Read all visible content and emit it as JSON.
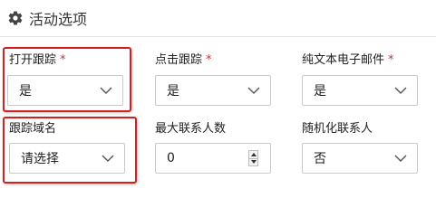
{
  "section": {
    "title": "活动选项",
    "icon": "gear-icon"
  },
  "required_mark": "*",
  "fields": {
    "open_tracking": {
      "label": "打开跟踪",
      "required": true,
      "value": "是"
    },
    "click_tracking": {
      "label": "点击跟踪",
      "required": true,
      "value": "是"
    },
    "plain_text_email": {
      "label": "纯文本电子邮件",
      "required": true,
      "value": "是"
    },
    "tracking_domain": {
      "label": "跟踪域名",
      "required": false,
      "value": "请选择"
    },
    "max_contacts": {
      "label": "最大联系人数",
      "required": false,
      "value": "0"
    },
    "randomize_contacts": {
      "label": "随机化联系人",
      "required": false,
      "value": "否"
    }
  },
  "colors": {
    "highlight": "#d21f1f",
    "required": "#d0312d",
    "border": "#c9c9c9"
  }
}
